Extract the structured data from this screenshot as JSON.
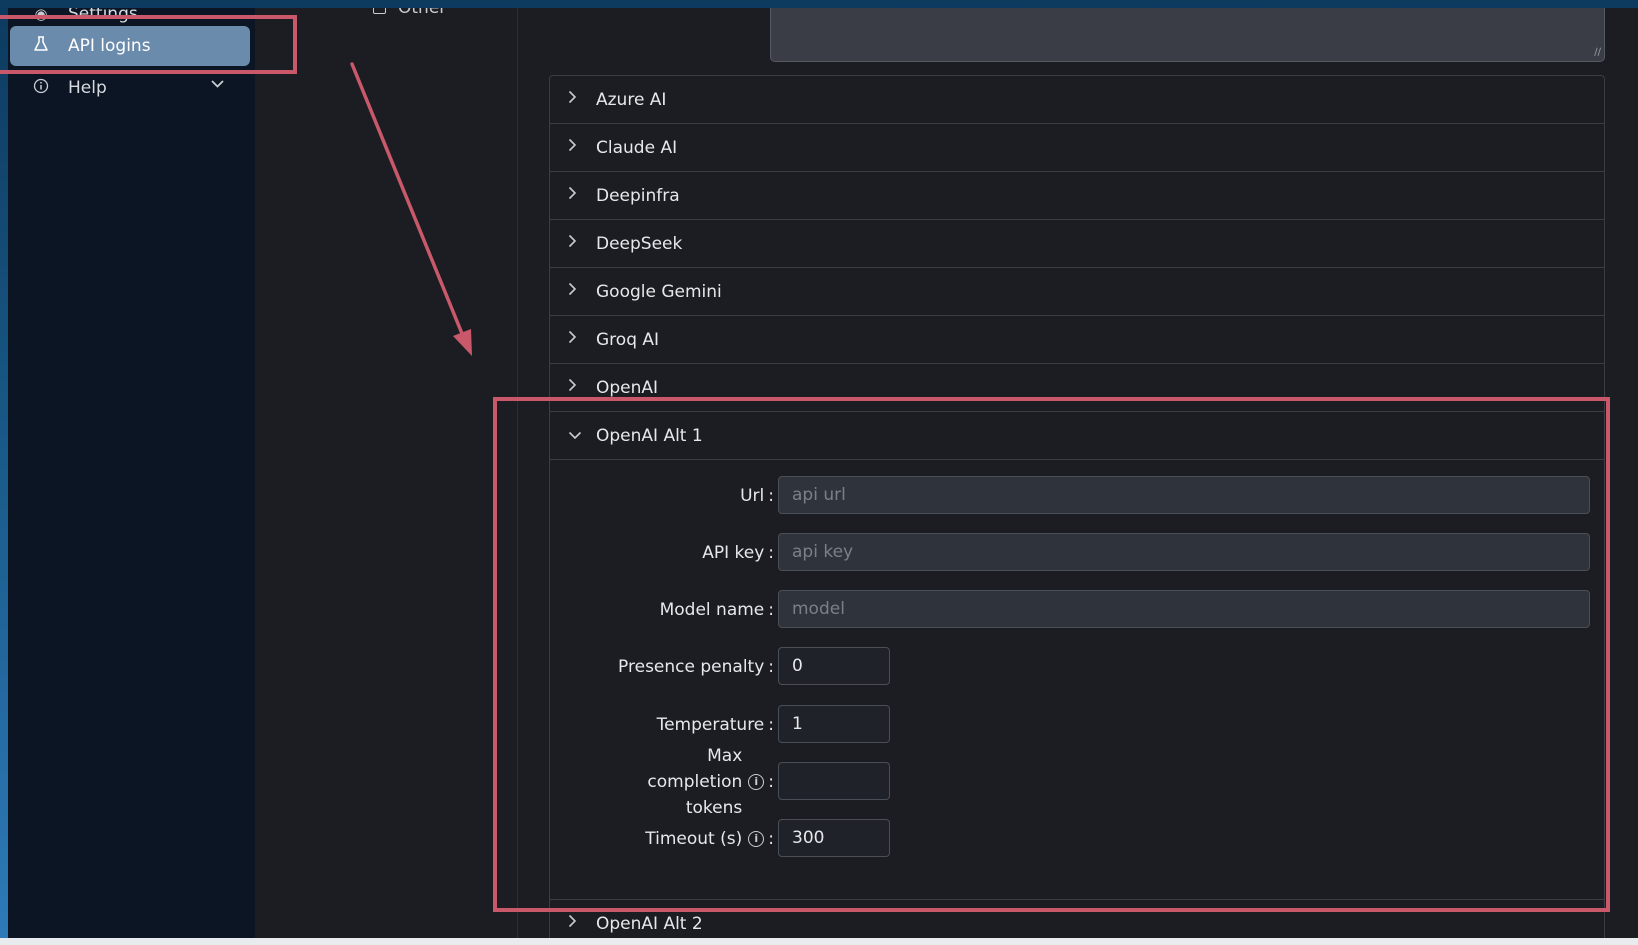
{
  "sidebar": {
    "items": [
      {
        "label": "Settings",
        "icon": "eye-icon"
      },
      {
        "label": "API logins",
        "icon": "flask-icon",
        "active": true
      },
      {
        "label": "Help",
        "icon": "info-icon"
      }
    ]
  },
  "subnav": {
    "label": "Other"
  },
  "providers": [
    "Azure AI",
    "Claude AI",
    "Deepinfra",
    "DeepSeek",
    "Google Gemini",
    "Groq AI",
    "OpenAI",
    "OpenAI Alt 1",
    "OpenAI Alt 2"
  ],
  "form": {
    "url": {
      "label": "Url",
      "value": "",
      "placeholder": "api url"
    },
    "api_key": {
      "label": "API key",
      "value": "",
      "placeholder": "api key"
    },
    "model_name": {
      "label": "Model name",
      "value": "",
      "placeholder": "model"
    },
    "presence_penalty": {
      "label": "Presence penalty",
      "value": "0"
    },
    "temperature": {
      "label": "Temperature",
      "value": "1"
    },
    "max_completion_tokens": {
      "label": "Max completion tokens",
      "value": ""
    },
    "timeout": {
      "label": "Timeout (s)",
      "value": "300"
    },
    "colon": ":"
  },
  "colors": {
    "highlight": "#c9596a",
    "active_nav": "#6a8bab",
    "sidebar_bg": "#0b1524",
    "panel_bg": "#1b1d23"
  }
}
